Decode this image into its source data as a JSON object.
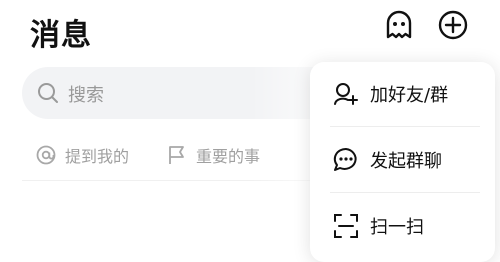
{
  "header": {
    "title": "消息",
    "ghost_icon": "ghost-icon",
    "add_icon": "plus-circle-icon"
  },
  "search": {
    "placeholder": "搜索",
    "icon": "search-icon"
  },
  "filters": [
    {
      "label": "提到我的",
      "icon": "at-icon"
    },
    {
      "label": "重要的事",
      "icon": "flag-icon"
    }
  ],
  "menu": {
    "items": [
      {
        "label": "加好友/群",
        "icon": "add-friend-icon"
      },
      {
        "label": "发起群聊",
        "icon": "chat-bubble-icon"
      },
      {
        "label": "扫一扫",
        "icon": "scan-icon"
      }
    ]
  }
}
